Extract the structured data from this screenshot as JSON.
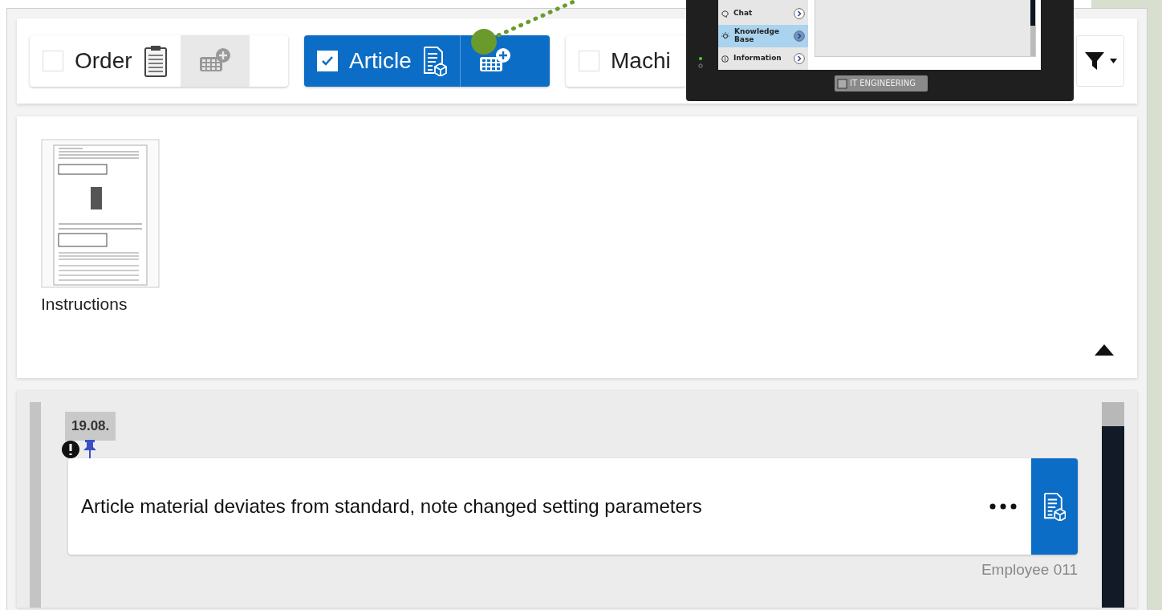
{
  "filters": [
    {
      "kind": "order",
      "label": "Order",
      "checked": false
    },
    {
      "kind": "article",
      "label": "Article",
      "checked": true
    },
    {
      "kind": "machine",
      "label": "Machi",
      "checked": false
    }
  ],
  "attachments": {
    "expanded": true,
    "items": [
      {
        "label": "Instructions"
      }
    ]
  },
  "timeline": [
    {
      "date": "19.08.",
      "important": true,
      "pinned": true,
      "text": "Article material deviates from standard, note changed setting parameters",
      "author": "Employee 011"
    }
  ],
  "device": {
    "menu": [
      {
        "kind": "chat",
        "label": "Chat",
        "selected": false
      },
      {
        "kind": "knowledge",
        "label": "Knowledge Base",
        "selected": true
      },
      {
        "kind": "info",
        "label": "Information",
        "selected": false
      }
    ],
    "logo": "IT ENGINEERING"
  }
}
